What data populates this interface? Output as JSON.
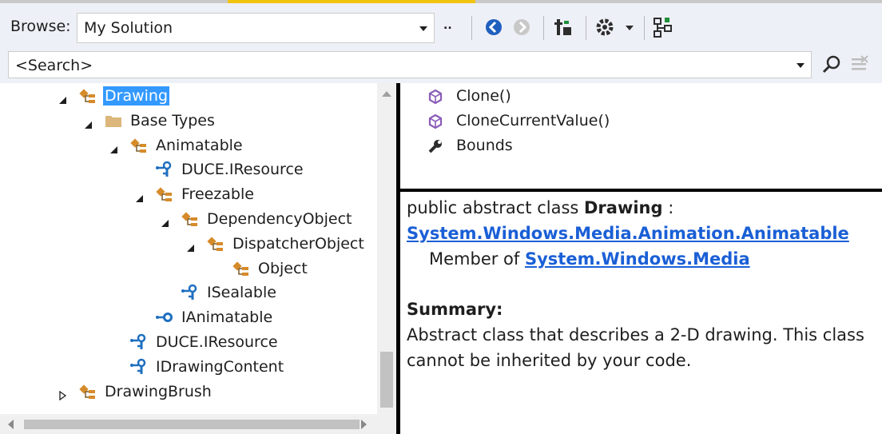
{
  "toolbar": {
    "browse_label": "Browse:",
    "browse_value": "My Solution",
    "more_label": "..",
    "buttons": [
      "back-icon",
      "forward-icon",
      "sort-icon",
      "settings-icon",
      "view-options-icon"
    ]
  },
  "search": {
    "value": "<Search>"
  },
  "tree": {
    "nodes": [
      {
        "label": "Drawing",
        "depth": 0,
        "expander": "expanded",
        "icon": "class-icon",
        "selected": true
      },
      {
        "label": "Base Types",
        "depth": 1,
        "expander": "expanded",
        "icon": "folder-icon"
      },
      {
        "label": "Animatable",
        "depth": 2,
        "expander": "expanded",
        "icon": "class-icon"
      },
      {
        "label": "DUCE.IResource",
        "depth": 3,
        "expander": "none",
        "icon": "interface-icon"
      },
      {
        "label": "Freezable",
        "depth": 3,
        "expander": "expanded",
        "icon": "class-icon"
      },
      {
        "label": "DependencyObject",
        "depth": 4,
        "expander": "expanded",
        "icon": "class-icon"
      },
      {
        "label": "DispatcherObject",
        "depth": 5,
        "expander": "expanded",
        "icon": "class-icon"
      },
      {
        "label": "Object",
        "depth": 6,
        "expander": "none",
        "icon": "class-icon"
      },
      {
        "label": "ISealable",
        "depth": 4,
        "expander": "none",
        "icon": "interface-icon"
      },
      {
        "label": "IAnimatable",
        "depth": 3,
        "expander": "none",
        "icon": "interface-small-icon"
      },
      {
        "label": "DUCE.IResource",
        "depth": 2,
        "expander": "none",
        "icon": "interface-icon"
      },
      {
        "label": "IDrawingContent",
        "depth": 2,
        "expander": "none",
        "icon": "interface-icon"
      },
      {
        "label": "DrawingBrush",
        "depth": 0,
        "expander": "collapsed",
        "icon": "class-icon"
      }
    ]
  },
  "members": [
    {
      "label": "Clone()",
      "icon": "method-icon"
    },
    {
      "label": "CloneCurrentValue()",
      "icon": "method-icon"
    },
    {
      "label": "Bounds",
      "icon": "property-icon"
    }
  ],
  "details": {
    "declaration_prefix": "public abstract class ",
    "class_name": "Drawing",
    "declaration_suffix": " :",
    "base_link": "System.Windows.Media.Animation.Animatable",
    "member_of_prefix": "Member of ",
    "namespace_link": "System.Windows.Media",
    "summary_heading": "Summary:",
    "summary_line1": "Abstract class that describes a 2-D drawing. This class",
    "summary_line2": "cannot be inherited by your code."
  },
  "colors": {
    "selection": "#3399ff",
    "class_icon": "#d68b2a",
    "interface_icon": "#1f6fbf",
    "method_icon": "#8a5cb8",
    "link": "#1a5fd6"
  }
}
